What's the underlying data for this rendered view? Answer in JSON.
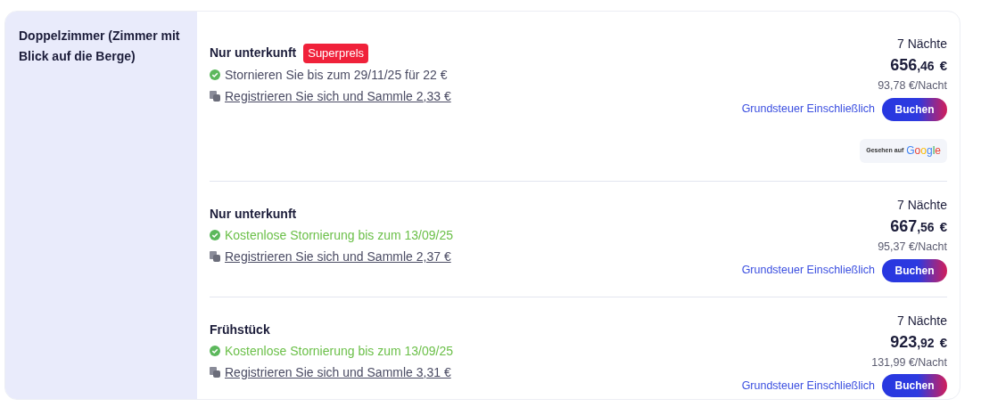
{
  "room": {
    "title": "Doppelzimmer (Zimmer mit Blick auf die Berge)"
  },
  "offers": [
    {
      "name": "Nur unterkunft",
      "badge": "Superprels",
      "cancellation": {
        "kind": "paid",
        "text": "Stornieren Sie bis zum 29/11/25 für 22 €"
      },
      "reward_link": "Registrieren Sie sich und Sammle 2,33 €",
      "nights": "7 Nächte",
      "price_main": "656",
      "price_cents": ",46",
      "currency": "€",
      "per_night": "93,78 €/Nacht",
      "tax_note": "Grundsteuer Einschließlich",
      "book_button": "Buchen",
      "source": {
        "prefix": "Gesehen auf",
        "brand": "Google"
      }
    },
    {
      "name": "Nur unterkunft",
      "cancellation": {
        "kind": "free",
        "text": "Kostenlose Stornierung bis zum 13/09/25"
      },
      "reward_link": "Registrieren Sie sich und Sammle 2,37 €",
      "nights": "7 Nächte",
      "price_main": "667",
      "price_cents": ",56",
      "currency": "€",
      "per_night": "95,37 €/Nacht",
      "tax_note": "Grundsteuer Einschließlich",
      "book_button": "Buchen"
    },
    {
      "name": "Frühstück",
      "cancellation": {
        "kind": "free",
        "text": "Kostenlose Stornierung bis zum 13/09/25"
      },
      "reward_link": "Registrieren Sie sich und Sammle 3,31 €",
      "nights": "7 Nächte",
      "price_main": "923",
      "price_cents": ",92",
      "currency": "€",
      "per_night": "131,99 €/Nacht",
      "tax_note": "Grundsteuer Einschließlich",
      "book_button": "Buchen"
    }
  ]
}
